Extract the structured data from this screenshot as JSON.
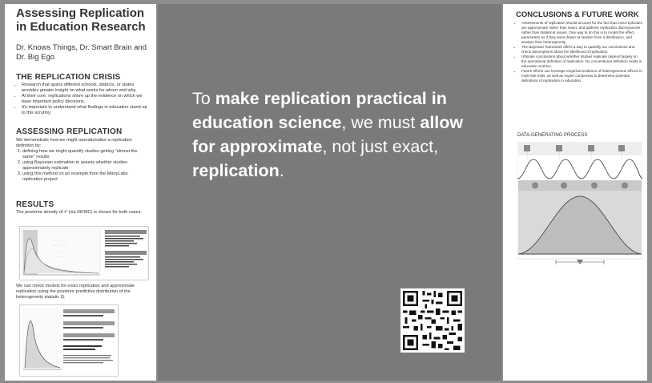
{
  "left": {
    "title": "Assessing Replication in Education Research",
    "authors": "Dr. Knows Things, Dr. Smart Brain and Dr. Big Ego",
    "crisis_heading": "THE REPLICATION CRISIS",
    "crisis_bullets": [
      "Research that spans different schools, districts, or states provides greater insight on what works for whom and why.",
      "At their core, replications shore up the evidence on which we base important policy decisions.",
      "It's important to understand what findings in education stand up to this scrutiny."
    ],
    "assess_heading": "ASSESSING REPLICATION",
    "assess_intro": "We demonstrate how we might operationalize a replication definition by:",
    "assess_steps": [
      "defining how we might quantify studies getting \"almost the same\" results",
      "using Bayesian estimation to assess whether studies approximately replicate",
      "using this method on an example from the ManyLabs replication project"
    ],
    "results_heading": "RESULTS",
    "results_text": "The posterior density of τ² (via MCMC) is shown for both cases.",
    "results_text2": "We can check models for exact replication and approximate replication using the posterior predictive distribution of the heterogeneity statistic Q."
  },
  "center": {
    "headline_parts": [
      {
        "text": "To ",
        "bold": false
      },
      {
        "text": "make replication practical in education science",
        "bold": true
      },
      {
        "text": ", we must ",
        "bold": false
      },
      {
        "text": "allow for approximate",
        "bold": true
      },
      {
        "text": ", not just exact, ",
        "bold": false
      },
      {
        "text": "replication",
        "bold": true
      },
      {
        "text": ".",
        "bold": false
      }
    ]
  },
  "right": {
    "heading": "CONCLUSIONS & FUTURE WORK",
    "bullets": [
      "Assessments of replication should account for the fact that most replicates are approximate rather than exact, and address replication discrepancies rather than statistical issues. One way to do this is to model the effect parameters as if they were drawn at random from a distribution, and analyze their heterogeneity.",
      "The Bayesian framework offers a way to quantify our conclusions and check assumptions about the likelihood of replication.",
      "Ultimate conclusions about whether studies replicate depend largely on the operational definition of replication. No conventional definition exists in education science.",
      "Future efforts can leverage empirical evidence of heterogeneous effects in multi-site trials, as well as expert consensus to determine potential definitions of replication in education."
    ],
    "dgp_title": "DATA-GENERATING PROCESS"
  },
  "colors": {
    "background": "#8d8d8d",
    "center_panel": "#7a7a7a",
    "headline_text": "#ffffff"
  }
}
